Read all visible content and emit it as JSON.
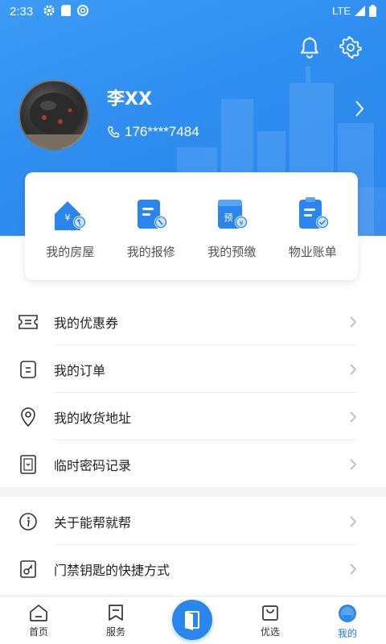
{
  "status_bar": {
    "time": "2:33",
    "network": "LTE"
  },
  "profile": {
    "name": "李XX",
    "phone": "176****7484"
  },
  "quick_actions": [
    {
      "label": "我的房屋",
      "icon": "house-key-icon"
    },
    {
      "label": "我的报修",
      "icon": "repair-icon"
    },
    {
      "label": "我的预缴",
      "icon": "prepay-icon"
    },
    {
      "label": "物业账单",
      "icon": "bill-icon"
    }
  ],
  "menu_group_1": [
    {
      "label": "我的优惠券",
      "icon": "coupon-icon"
    },
    {
      "label": "我的订单",
      "icon": "order-icon"
    },
    {
      "label": "我的收货地址",
      "icon": "location-icon"
    },
    {
      "label": "临时密码记录",
      "icon": "temp-password-icon"
    }
  ],
  "menu_group_2": [
    {
      "label": "关于能帮就帮",
      "icon": "info-icon"
    },
    {
      "label": "门禁钥匙的快捷方式",
      "icon": "door-key-icon"
    }
  ],
  "tabs": [
    {
      "label": "首页",
      "icon": "home-icon"
    },
    {
      "label": "服务",
      "icon": "service-icon"
    },
    {
      "label": "",
      "icon": "door-icon"
    },
    {
      "label": "优选",
      "icon": "shopping-bag-icon"
    },
    {
      "label": "我的",
      "icon": "profile-icon"
    }
  ],
  "active_tab": "我的",
  "colors": {
    "primary": "#2a86ec",
    "header": "#3b9bf5",
    "text": "#222222"
  }
}
